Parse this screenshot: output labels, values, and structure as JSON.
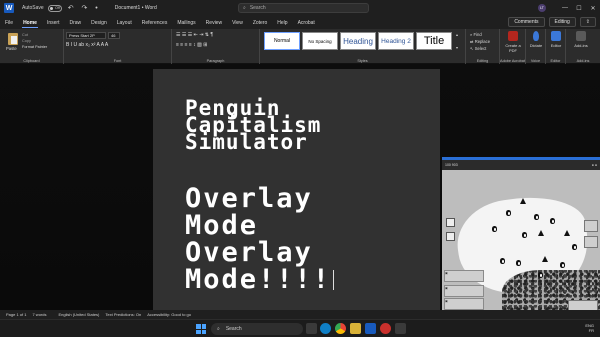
{
  "titlebar": {
    "app_icon": "W",
    "autosave_label": "AutoSave",
    "autosave_state": "Off",
    "quick_access": "↶ ↷ •",
    "doc_title": "Document1 • Word",
    "search_placeholder": "Search",
    "avatar_initials": "LT",
    "minimize": "—",
    "maximize": "☐",
    "close": "✕"
  },
  "tabs": {
    "items": [
      "File",
      "Home",
      "Insert",
      "Draw",
      "Design",
      "Layout",
      "References",
      "Mailings",
      "Review",
      "View",
      "Zotero",
      "Help",
      "Acrobat"
    ],
    "active": "Home",
    "comments_label": "Comments",
    "editing_label": "Editing",
    "share_label": "⇪"
  },
  "ribbon": {
    "clipboard": {
      "paste_label": "Paste",
      "cut_label": "Cut",
      "copy_label": "Copy",
      "format_painter_label": "Format Painter",
      "group_label": "Clipboard"
    },
    "font": {
      "font_name": "Press Start 2P",
      "font_size": "46",
      "format_buttons": "B I U ab x₂ x² A A A",
      "group_label": "Font"
    },
    "paragraph": {
      "row1": "☰ ☰ ☰ ⇤ ⇥ ⇅ ¶",
      "row2": "≡ ≡ ≡ ≡ ↕ ▧ ⊞",
      "group_label": "Paragraph"
    },
    "styles": {
      "items": [
        "Normal",
        "No Spacing",
        "Heading",
        "Heading 2",
        "Title"
      ],
      "group_label": "Styles"
    },
    "editing": {
      "find_label": "Find",
      "replace_label": "Replace",
      "select_label": "Select",
      "group_label": "Editing"
    },
    "adobe": {
      "label": "Create a PDF",
      "group_label": "Adobe Acrobat"
    },
    "voice": {
      "label": "Dictate",
      "group_label": "Voice"
    },
    "editor": {
      "label": "Editor",
      "group_label": "Editor"
    },
    "addin": {
      "label": "Add-ins",
      "group_label": "Add-ins"
    }
  },
  "document": {
    "heading_lines": "Penguin\nCapitalism\nSimulator",
    "body_lines": "Overlay\nMode\nOverlay\nMode!!!!"
  },
  "game": {
    "top_left": "100 903",
    "top_right": "● ●",
    "panel_labels": [
      "▣",
      "▣",
      "▣",
      "▣"
    ]
  },
  "statusbar": {
    "page": "Page 1 of 1",
    "words": "7 words",
    "language": "English (United States)",
    "predictions": "Text Predictions: On",
    "accessibility": "Accessibility: Good to go"
  },
  "taskbar": {
    "search_placeholder": "Search",
    "tray_lang": "ENG",
    "tray_region": "FR"
  },
  "colors": {
    "accent": "#6ea0ff",
    "word_blue": "#185abd",
    "overlay_border": "#2a6fd6"
  }
}
